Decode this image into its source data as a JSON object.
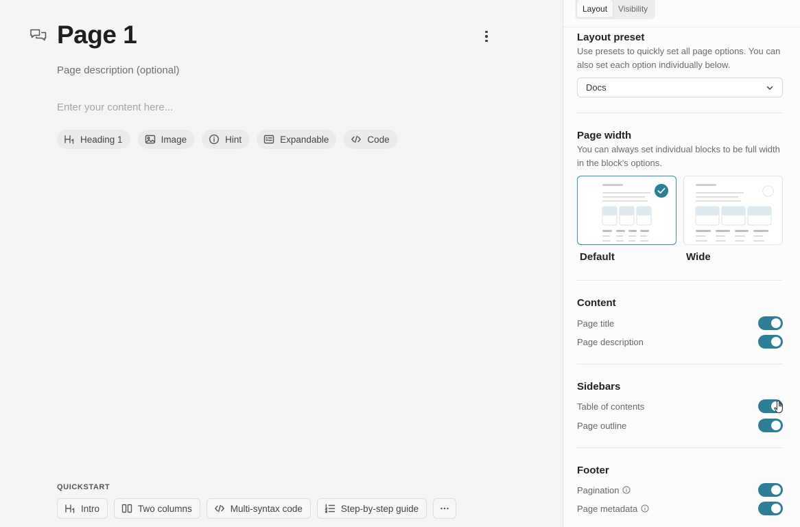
{
  "editor": {
    "title": "Page 1",
    "description_placeholder": "Page description (optional)",
    "content_placeholder": "Enter your content here...",
    "insert_chips": [
      {
        "icon": "heading-icon",
        "label": "Heading 1"
      },
      {
        "icon": "image-icon",
        "label": "Image"
      },
      {
        "icon": "info-icon",
        "label": "Hint"
      },
      {
        "icon": "expandable-icon",
        "label": "Expandable"
      },
      {
        "icon": "code-icon",
        "label": "Code"
      }
    ],
    "quickstart": {
      "label": "QUICKSTART",
      "items": [
        {
          "icon": "heading-icon",
          "label": "Intro"
        },
        {
          "icon": "columns-icon",
          "label": "Two columns"
        },
        {
          "icon": "code-icon",
          "label": "Multi-syntax code"
        },
        {
          "icon": "steps-icon",
          "label": "Step-by-step guide"
        }
      ]
    }
  },
  "panel": {
    "tabs": [
      {
        "label": "Layout",
        "active": true
      },
      {
        "label": "Visibility",
        "active": false
      }
    ],
    "layout_preset": {
      "title": "Layout preset",
      "description": "Use presets to quickly set all page options. You can also set each option individually below.",
      "selected": "Docs"
    },
    "page_width": {
      "title": "Page width",
      "description": "You can always set individual blocks to be full width in the block's options.",
      "options": [
        {
          "label": "Default",
          "selected": true
        },
        {
          "label": "Wide",
          "selected": false
        }
      ]
    },
    "content": {
      "title": "Content",
      "toggles": [
        {
          "label": "Page title",
          "on": true
        },
        {
          "label": "Page description",
          "on": true
        }
      ]
    },
    "sidebars": {
      "title": "Sidebars",
      "toggles": [
        {
          "label": "Table of contents",
          "on": true
        },
        {
          "label": "Page outline",
          "on": true
        }
      ]
    },
    "footer": {
      "title": "Footer",
      "toggles": [
        {
          "label": "Pagination",
          "on": true,
          "info": true
        },
        {
          "label": "Page metadata",
          "on": true,
          "info": true
        }
      ]
    }
  },
  "colors": {
    "accent": "#2f7e98",
    "background": "#f5f5f4",
    "panel": "#fcfcfc"
  }
}
